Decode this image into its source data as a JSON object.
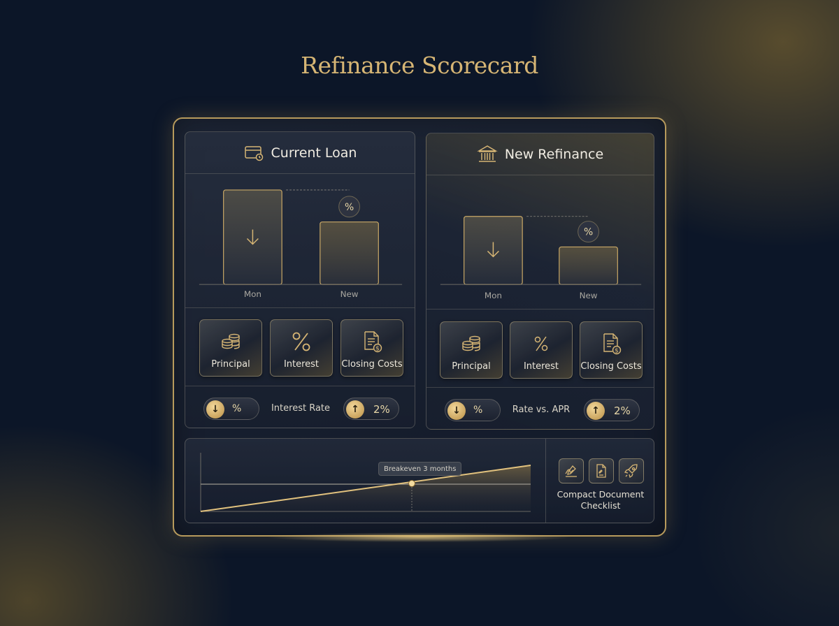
{
  "page": {
    "title": "Refinance Scorecard"
  },
  "panels": [
    {
      "title": "Current Loan",
      "header_icon": "card-clock-icon",
      "bars": [
        {
          "label": "Mon",
          "icon": "arrow-down-icon"
        },
        {
          "label": "New",
          "icon": "percent-icon"
        }
      ],
      "tiles": [
        {
          "label": "Principal",
          "icon": "coins-icon"
        },
        {
          "label": "Interest",
          "icon": "percent-icon"
        },
        {
          "label": "Closing Costs",
          "icon": "document-dollar-icon"
        }
      ],
      "rate_label": "Interest Rate",
      "left_pill": {
        "value": "%",
        "icon": "arrow-down-icon"
      },
      "right_pill": {
        "value": "2%",
        "icon": "arrow-up-icon"
      }
    },
    {
      "title": "New Refinance",
      "header_icon": "bank-icon",
      "bars": [
        {
          "label": "Mon",
          "icon": "arrow-down-icon"
        },
        {
          "label": "New",
          "icon": "percent-icon"
        }
      ],
      "tiles": [
        {
          "label": "Principal",
          "icon": "coins-icon"
        },
        {
          "label": "Interest",
          "icon": "percent-icon"
        },
        {
          "label": "Closing Costs",
          "icon": "document-dollar-icon"
        }
      ],
      "rate_label": "Rate vs. APR",
      "left_pill": {
        "value": "%",
        "icon": "arrow-down-icon"
      },
      "right_pill": {
        "value": "2%",
        "icon": "arrow-up-icon"
      }
    }
  ],
  "breakeven": {
    "tag": "Breakeven 3 months",
    "checklist_label": "Compact Document Checklist",
    "checklist_icons": [
      "signature-icon",
      "document-edit-icon",
      "rocket-icon"
    ]
  },
  "colors": {
    "accent_gold": "#d6b574",
    "background": "#0c1628"
  }
}
